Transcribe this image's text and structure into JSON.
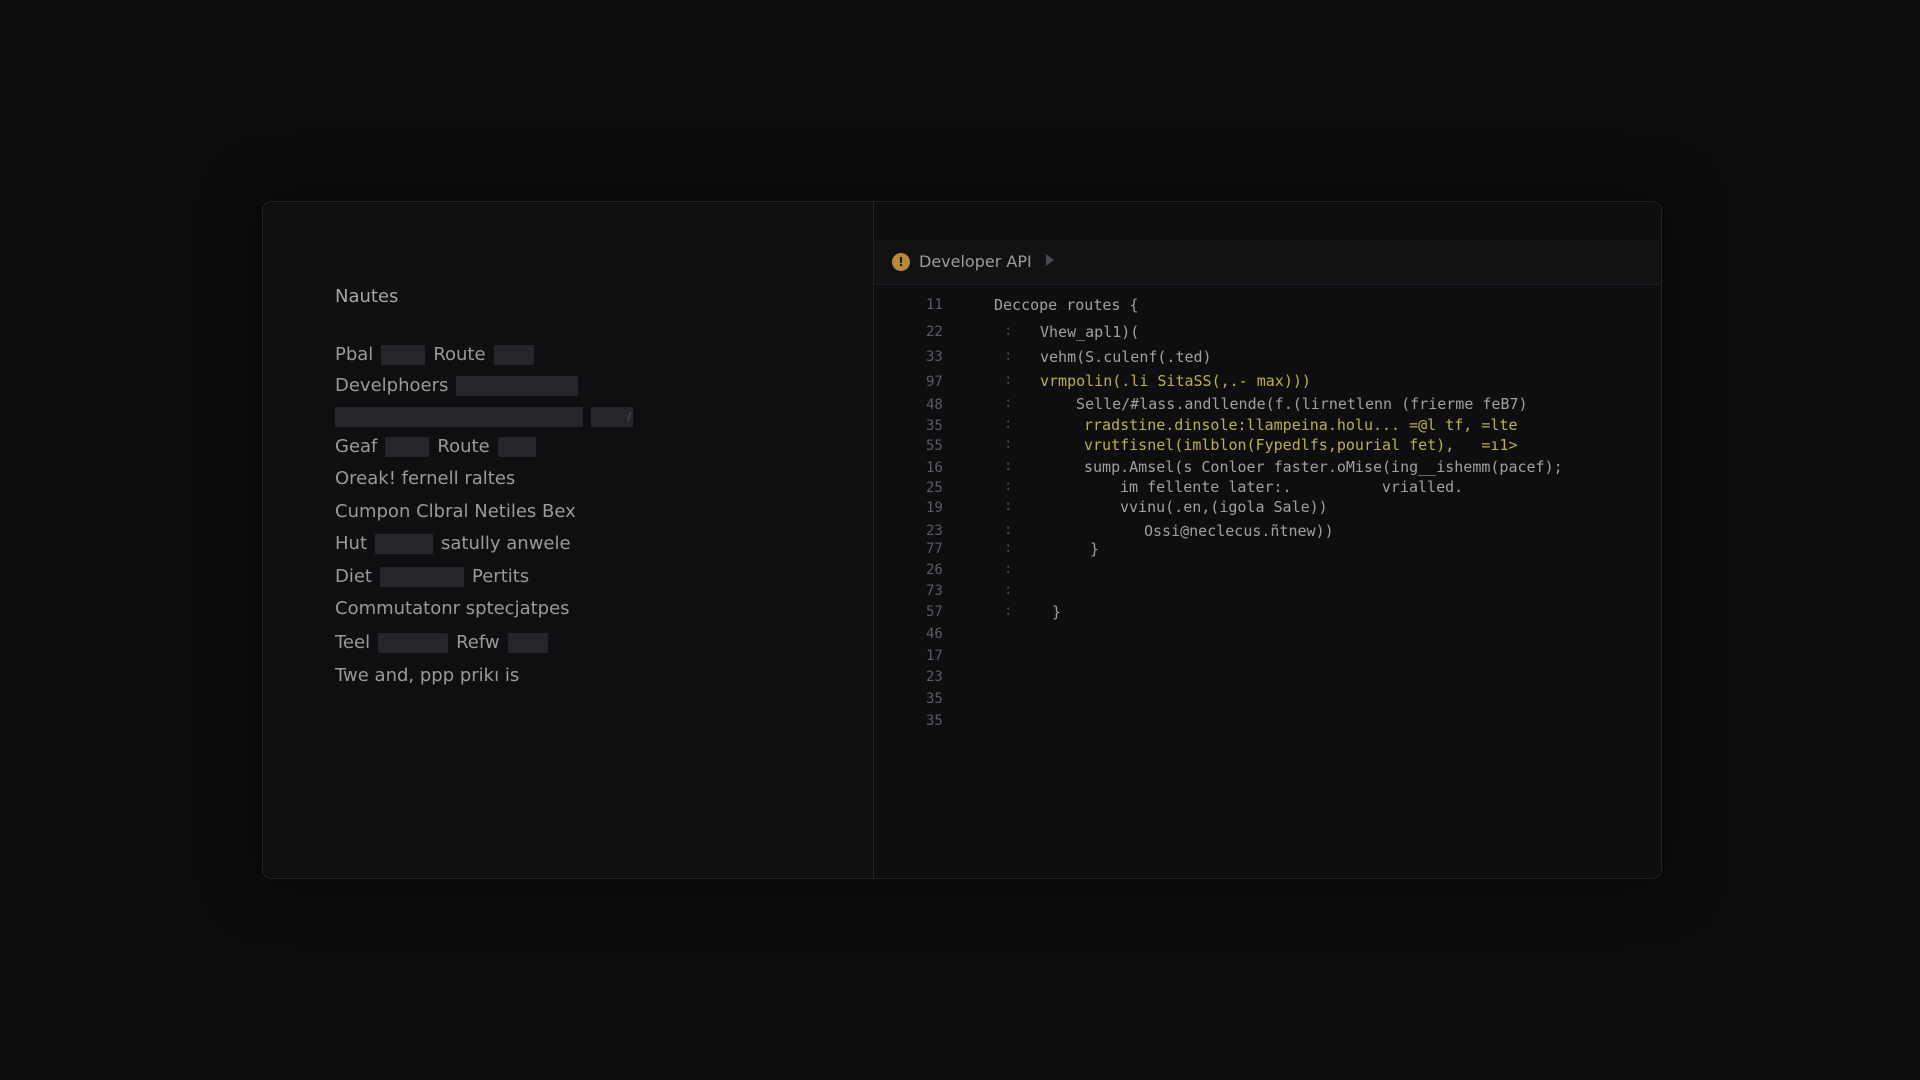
{
  "left_panel": {
    "title": "Nautes",
    "rows": [
      {
        "parts": [
          "Pbal",
          "",
          "Route",
          ""
        ]
      },
      {
        "parts": [
          "Develphoers",
          ""
        ]
      },
      {
        "parts": [
          "",
          "/"
        ]
      },
      {
        "parts": [
          "Geaf",
          "",
          "Route",
          ""
        ]
      },
      {
        "parts": [
          "Oreak! fernell raltes"
        ]
      },
      {
        "parts": [
          "Cumpon Clbral Netiles Bex"
        ]
      },
      {
        "parts": [
          "Hut",
          "",
          "satully anwele"
        ]
      },
      {
        "parts": [
          "Diet",
          "",
          "Pertits"
        ]
      },
      {
        "parts": [
          "Commutatonr sptecjatpes"
        ]
      },
      {
        "parts": [
          "Teel",
          "",
          "Refw",
          ""
        ]
      },
      {
        "parts": [
          "Twe and, ppp prikı is"
        ]
      }
    ]
  },
  "tab": {
    "icon": "warning-icon",
    "icon_glyph": "!",
    "label": "Developer API"
  },
  "code": {
    "line_numbers": [
      "11",
      "22",
      "33",
      "97",
      "48",
      "35",
      "55",
      "16",
      "25",
      "19",
      "23",
      "77",
      "26",
      "73",
      "57",
      "46",
      "17",
      "23",
      "35",
      "35"
    ],
    "lines": [
      {
        "guide": "",
        "text": "Deccope routes {",
        "color": "plain"
      },
      {
        "guide": ":",
        "text": "Vhew_apl1)(",
        "color": "plain"
      },
      {
        "guide": ":",
        "text": "vehm(S.culenf(.ted)",
        "color": "plain"
      },
      {
        "guide": ":",
        "text": "vrmpolin(.li SitaSS(,.- max)))",
        "color": "yellow"
      },
      {
        "guide": ":",
        "text": "Selle/#lass.andllende(f.(lirnetlenn (frierme feB7)",
        "color": "plain"
      },
      {
        "guide": ":",
        "text": "rradstine.dinsole:llampeina.holu... =@l tf, =lte",
        "color": "yellow"
      },
      {
        "guide": ":",
        "text": "vrutfisnel(imlblon(Fypedlfs,pourial fet),   =ı1>",
        "color": "yellow"
      },
      {
        "guide": ":",
        "text": "sump.Amsel(s Conloer faster.oMise(ing__ishemm(pacef);",
        "color": "plain"
      },
      {
        "guide": ":",
        "text": "im fellente later:.          vrialled.",
        "color": "plain"
      },
      {
        "guide": ":",
        "text": "vvinu(.en,(igola Sale))",
        "color": "plain"
      },
      {
        "guide": ":",
        "text": "Ossi@neclecus.ñtnew))",
        "color": "plain"
      },
      {
        "guide": ":",
        "text": "}",
        "color": "plain"
      },
      {
        "guide": ":",
        "text": "",
        "color": "plain"
      },
      {
        "guide": ":",
        "text": "",
        "color": "plain"
      },
      {
        "guide": ":",
        "text": "}",
        "color": "plain"
      }
    ]
  }
}
